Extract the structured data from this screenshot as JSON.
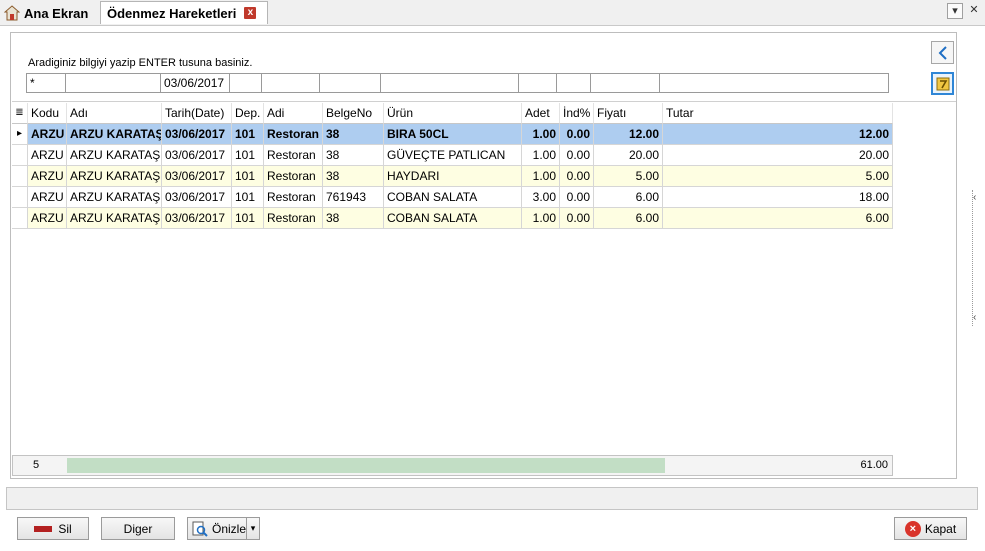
{
  "tabs": {
    "home": "Ana Ekran",
    "active": "Ödenmez Hareketleri",
    "close": "x",
    "home_icon": "home-icon"
  },
  "strip_controls": {
    "dropdown": "▾",
    "minimize": "—",
    "close": "✕"
  },
  "search": {
    "hint": "Aradiginiz bilgiyi yazip ENTER tusuna basiniz."
  },
  "filters": [
    "*",
    "",
    "03/06/2017",
    "",
    "",
    "",
    "",
    "",
    "",
    "",
    ""
  ],
  "columns": [
    "Kodu",
    "Adı",
    "Tarih(Date)",
    "Dep.",
    "Adi",
    "BelgeNo",
    "Ürün",
    "Adet",
    "İnd%",
    "Fiyatı",
    "Tutar"
  ],
  "rows": [
    [
      "ARZU",
      "ARZU KARATAŞ",
      "03/06/2017",
      "101",
      "Restoran",
      "38",
      "BIRA 50CL",
      "1.00",
      "0.00",
      "12.00",
      "12.00"
    ],
    [
      "ARZU",
      "ARZU KARATAŞ",
      "03/06/2017",
      "101",
      "Restoran",
      "38",
      "GÜVEÇTE PATLICAN",
      "1.00",
      "0.00",
      "20.00",
      "20.00"
    ],
    [
      "ARZU",
      "ARZU KARATAŞ",
      "03/06/2017",
      "101",
      "Restoran",
      "38",
      "HAYDARI",
      "1.00",
      "0.00",
      "5.00",
      "5.00"
    ],
    [
      "ARZU",
      "ARZU KARATAŞ",
      "03/06/2017",
      "101",
      "Restoran",
      "761943",
      "COBAN SALATA",
      "3.00",
      "0.00",
      "6.00",
      "18.00"
    ],
    [
      "ARZU",
      "ARZU KARATAŞ",
      "03/06/2017",
      "101",
      "Restoran",
      "38",
      "COBAN SALATA",
      "1.00",
      "0.00",
      "6.00",
      "6.00"
    ]
  ],
  "footer": {
    "count": "5",
    "total": "61.00"
  },
  "buttons": {
    "sil": "Sil",
    "diger": "Diger",
    "onizle": "Önizle",
    "kapat": "Kapat"
  },
  "icons": {
    "row_indicator": "▸",
    "column_chooser": "≣",
    "nav_back": "chevron-left-icon",
    "filter_clear": "clear-filter-icon",
    "kapat": "×"
  },
  "colors": {
    "selected": "#aecdf0",
    "alt_row": "#fefee2",
    "accent": "#2f86d6",
    "delete": "#b32020"
  }
}
